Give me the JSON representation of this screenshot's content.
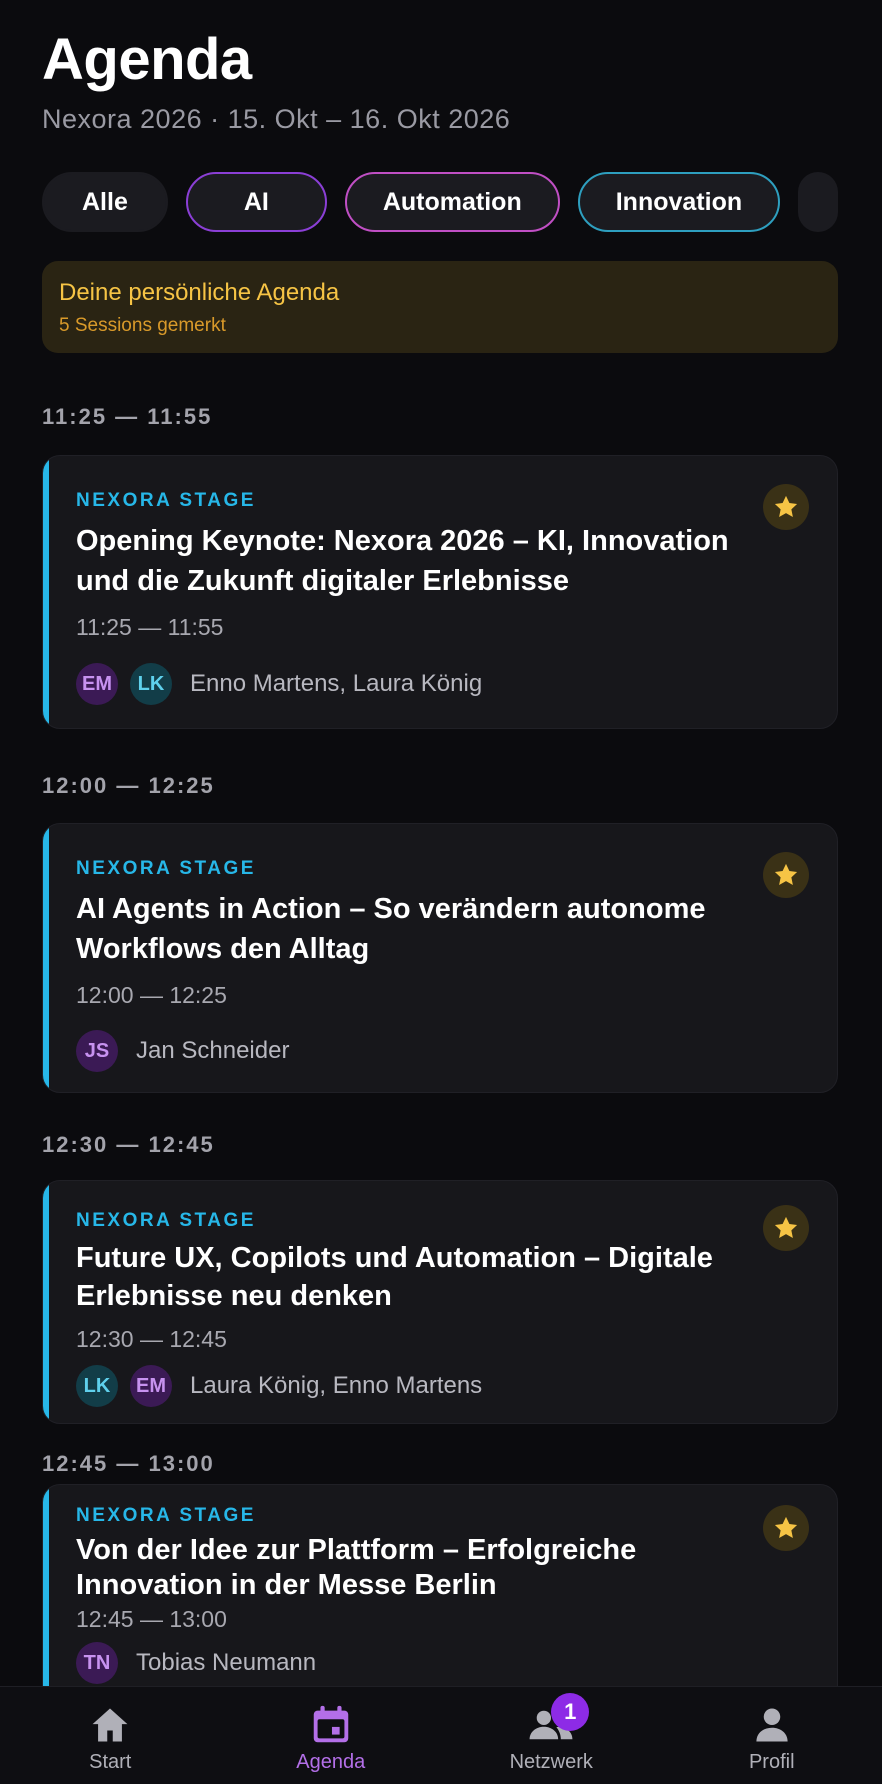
{
  "header": {
    "title": "Agenda",
    "subtitle": "Nexora 2026 · 15. Okt – 16. Okt 2026"
  },
  "filters": [
    {
      "label": "Alle"
    },
    {
      "label": "AI"
    },
    {
      "label": "Automation"
    },
    {
      "label": "Innovation"
    }
  ],
  "banner": {
    "title": "Deine persönliche Agenda",
    "subtitle": "5 Sessions gemerkt"
  },
  "slots": [
    {
      "time": "11:25 — 11:55",
      "session": {
        "stage": "NEXORA STAGE",
        "title": "Opening Keynote: Nexora 2026 – KI, Innovation und die Zukunft digitaler Erlebnisse",
        "time": "11:25 — 11:55",
        "avatars": [
          "EM",
          "LK"
        ],
        "speakers": "Enno Martens, Laura König"
      }
    },
    {
      "time": "12:00 — 12:25",
      "session": {
        "stage": "NEXORA STAGE",
        "title": "AI Agents in Action – So verändern autonome Workflows den Alltag",
        "time": "12:00 — 12:25",
        "avatars": [
          "JS"
        ],
        "speakers": "Jan Schneider"
      }
    },
    {
      "time": "12:30 — 12:45",
      "session": {
        "stage": "NEXORA STAGE",
        "title": "Future UX, Copilots und Automation – Digitale Erlebnisse neu denken",
        "time": "12:30 — 12:45",
        "avatars": [
          "LK",
          "EM"
        ],
        "speakers": "Laura König, Enno Martens"
      }
    },
    {
      "time": "12:45 — 13:00",
      "session": {
        "stage": "NEXORA STAGE",
        "title": "Von der Idee zur Plattform – Erfolgreiche Innovation in der Messe Berlin",
        "time": "12:45 — 13:00",
        "avatars": [
          "TN"
        ],
        "speakers": "Tobias Neumann"
      }
    }
  ],
  "nav": {
    "start": "Start",
    "agenda": "Agenda",
    "netzwerk": "Netzwerk",
    "netzwerk_badge": "1",
    "profil": "Profil"
  },
  "colors": {
    "accent_stage": "#27b7e8",
    "accent_active": "#b36fe8",
    "star": "#f6c445",
    "banner_bg": "#2a2413"
  },
  "icons": {
    "star": "star-icon",
    "start": "home-icon",
    "agenda": "calendar-icon",
    "netzwerk": "people-icon",
    "profil": "person-icon"
  }
}
